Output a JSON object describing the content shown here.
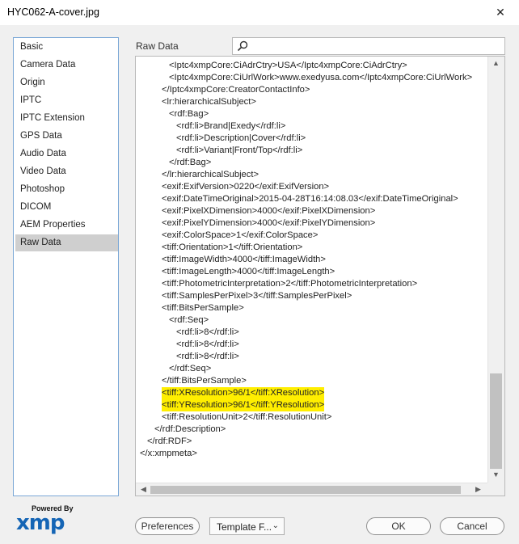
{
  "window": {
    "title": "HYC062-A-cover.jpg",
    "close_glyph": "✕"
  },
  "sidebar": {
    "items": [
      {
        "label": "Basic"
      },
      {
        "label": "Camera Data"
      },
      {
        "label": "Origin"
      },
      {
        "label": "IPTC"
      },
      {
        "label": "IPTC Extension"
      },
      {
        "label": "GPS Data"
      },
      {
        "label": "Audio Data"
      },
      {
        "label": "Video Data"
      },
      {
        "label": "Photoshop"
      },
      {
        "label": "DICOM"
      },
      {
        "label": "AEM Properties"
      },
      {
        "label": "Raw Data",
        "selected": true
      }
    ]
  },
  "panel": {
    "title": "Raw Data",
    "search": {
      "value": "",
      "placeholder": ""
    },
    "xml_lines": [
      {
        "indent": 4,
        "text": "<Iptc4xmpCore:CiAdrCtry>USA</Iptc4xmpCore:CiAdrCtry>"
      },
      {
        "indent": 4,
        "text": "<Iptc4xmpCore:CiUrlWork>www.exedyusa.com</Iptc4xmpCore:CiUrlWork>"
      },
      {
        "indent": 3,
        "text": "</Iptc4xmpCore:CreatorContactInfo>"
      },
      {
        "indent": 3,
        "text": "<lr:hierarchicalSubject>"
      },
      {
        "indent": 4,
        "text": "<rdf:Bag>"
      },
      {
        "indent": 5,
        "text": "<rdf:li>Brand|Exedy</rdf:li>"
      },
      {
        "indent": 5,
        "text": "<rdf:li>Description|Cover</rdf:li>"
      },
      {
        "indent": 5,
        "text": "<rdf:li>Variant|Front/Top</rdf:li>"
      },
      {
        "indent": 4,
        "text": "</rdf:Bag>"
      },
      {
        "indent": 3,
        "text": "</lr:hierarchicalSubject>"
      },
      {
        "indent": 3,
        "text": "<exif:ExifVersion>0220</exif:ExifVersion>"
      },
      {
        "indent": 3,
        "text": "<exif:DateTimeOriginal>2015-04-28T16:14:08.03</exif:DateTimeOriginal>"
      },
      {
        "indent": 3,
        "text": "<exif:PixelXDimension>4000</exif:PixelXDimension>"
      },
      {
        "indent": 3,
        "text": "<exif:PixelYDimension>4000</exif:PixelYDimension>"
      },
      {
        "indent": 3,
        "text": "<exif:ColorSpace>1</exif:ColorSpace>"
      },
      {
        "indent": 3,
        "text": "<tiff:Orientation>1</tiff:Orientation>"
      },
      {
        "indent": 3,
        "text": "<tiff:ImageWidth>4000</tiff:ImageWidth>"
      },
      {
        "indent": 3,
        "text": "<tiff:ImageLength>4000</tiff:ImageLength>"
      },
      {
        "indent": 3,
        "text": "<tiff:PhotometricInterpretation>2</tiff:PhotometricInterpretation>"
      },
      {
        "indent": 3,
        "text": "<tiff:SamplesPerPixel>3</tiff:SamplesPerPixel>"
      },
      {
        "indent": 3,
        "text": "<tiff:BitsPerSample>"
      },
      {
        "indent": 4,
        "text": "<rdf:Seq>"
      },
      {
        "indent": 5,
        "text": "<rdf:li>8</rdf:li>"
      },
      {
        "indent": 5,
        "text": "<rdf:li>8</rdf:li>"
      },
      {
        "indent": 5,
        "text": "<rdf:li>8</rdf:li>"
      },
      {
        "indent": 4,
        "text": "</rdf:Seq>"
      },
      {
        "indent": 3,
        "text": "</tiff:BitsPerSample>"
      },
      {
        "indent": 3,
        "text": "<tiff:XResolution>96/1</tiff:XResolution>",
        "highlight": true
      },
      {
        "indent": 3,
        "text": "<tiff:YResolution>96/1</tiff:YResolution>",
        "highlight": true
      },
      {
        "indent": 3,
        "text": "<tiff:ResolutionUnit>2</tiff:ResolutionUnit>"
      },
      {
        "indent": 2,
        "text": "</rdf:Description>"
      },
      {
        "indent": 1,
        "text": "</rdf:RDF>"
      },
      {
        "indent": 0,
        "text": "</x:xmpmeta>"
      }
    ],
    "highlight_color": "#ffee00",
    "scroll_up": "▲",
    "scroll_down": "▼",
    "scroll_left": "◀",
    "scroll_right": "▶"
  },
  "footer": {
    "logo_tagline": "Powered By",
    "logo_text": "xmp",
    "preferences_label": "Preferences",
    "template_label": "Template F...",
    "template_chevron": "⌄",
    "ok_label": "OK",
    "cancel_label": "Cancel"
  },
  "colors": {
    "accent": "#1565b5",
    "selection": "#cfcfcf",
    "border": "#7aa7d6"
  }
}
